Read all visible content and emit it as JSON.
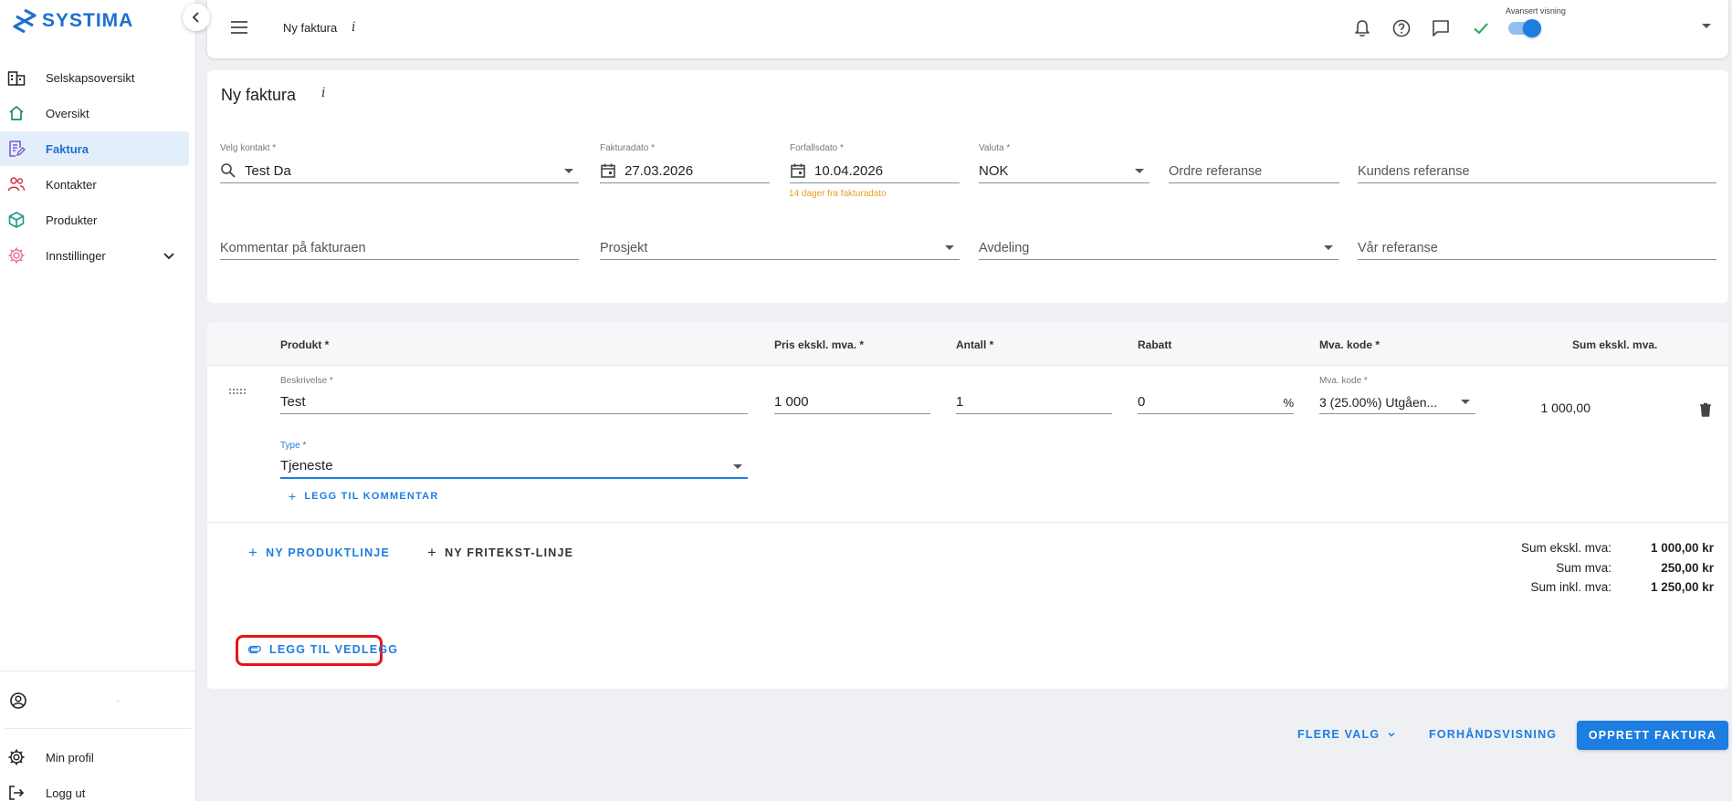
{
  "app": {
    "brand": "SYSTIMA"
  },
  "sidebar": {
    "items": [
      {
        "label": "Selskapsoversikt",
        "icon": "company-building-icon"
      },
      {
        "label": "Oversikt",
        "icon": "home-icon"
      },
      {
        "label": "Faktura",
        "icon": "invoice-icon",
        "active": true
      },
      {
        "label": "Kontakter",
        "icon": "people-icon"
      },
      {
        "label": "Produkter",
        "icon": "box-icon"
      },
      {
        "label": "Innstillinger",
        "icon": "gear-icon"
      }
    ],
    "bottom": {
      "user_name": "-",
      "profile_label": "Min profil",
      "logout_label": "Logg ut"
    }
  },
  "topbar": {
    "title": "Ny faktura",
    "info": "i",
    "advanced_label": "Avansert visning",
    "advanced_on": true
  },
  "invoice": {
    "title": "Ny faktura",
    "info": "i",
    "contact": {
      "label": "Velg kontakt *",
      "value": "Test Da"
    },
    "invoice_date": {
      "label": "Fakturadato *",
      "value": "27.03.2026"
    },
    "due_date": {
      "label": "Forfallsdato *",
      "value": "10.04.2026",
      "hint": "14 dager fra fakturadato"
    },
    "currency": {
      "label": "Valuta *",
      "value": "NOK"
    },
    "order_ref": {
      "placeholder": "Ordre referanse"
    },
    "customer_ref": {
      "placeholder": "Kundens referanse"
    },
    "comment": {
      "placeholder": "Kommentar på fakturaen"
    },
    "project": {
      "placeholder": "Prosjekt"
    },
    "department": {
      "placeholder": "Avdeling"
    },
    "our_ref": {
      "placeholder": "Vår referanse"
    }
  },
  "lines": {
    "headers": {
      "product": "Produkt *",
      "price": "Pris ekskl. mva. *",
      "qty": "Antall *",
      "discount": "Rabatt",
      "vat": "Mva. kode *",
      "sum": "Sum ekskl. mva."
    },
    "row": {
      "desc_label": "Beskrivelse *",
      "desc_value": "Test",
      "price": "1 000",
      "qty": "1",
      "discount": "0",
      "discount_unit": "%",
      "vat_label": "Mva. kode *",
      "vat_value": "3 (25.00%) Utgåen...",
      "sum": "1 000,00",
      "type_label": "Type *",
      "type_value": "Tjeneste",
      "add_comment": "LEGG TIL KOMMENTAR"
    },
    "new_product_line": "NY PRODUKTLINJE",
    "new_freetext_line": "NY FRITEKST-LINJE",
    "totals": [
      {
        "label": "Sum ekskl. mva:",
        "value": "1 000,00 kr"
      },
      {
        "label": "Sum mva:",
        "value": "250,00 kr"
      },
      {
        "label": "Sum inkl. mva:",
        "value": "1 250,00 kr"
      }
    ],
    "add_attachment": "LEGG TIL VEDLEGG"
  },
  "footer": {
    "more": "FLERE VALG",
    "preview": "FORHÅNDSVISNING",
    "create": "OPPRETT FAKTURA"
  },
  "colors": {
    "accent": "#1d7de0",
    "highlight_border": "#e8141a",
    "hint": "#e6a020"
  }
}
